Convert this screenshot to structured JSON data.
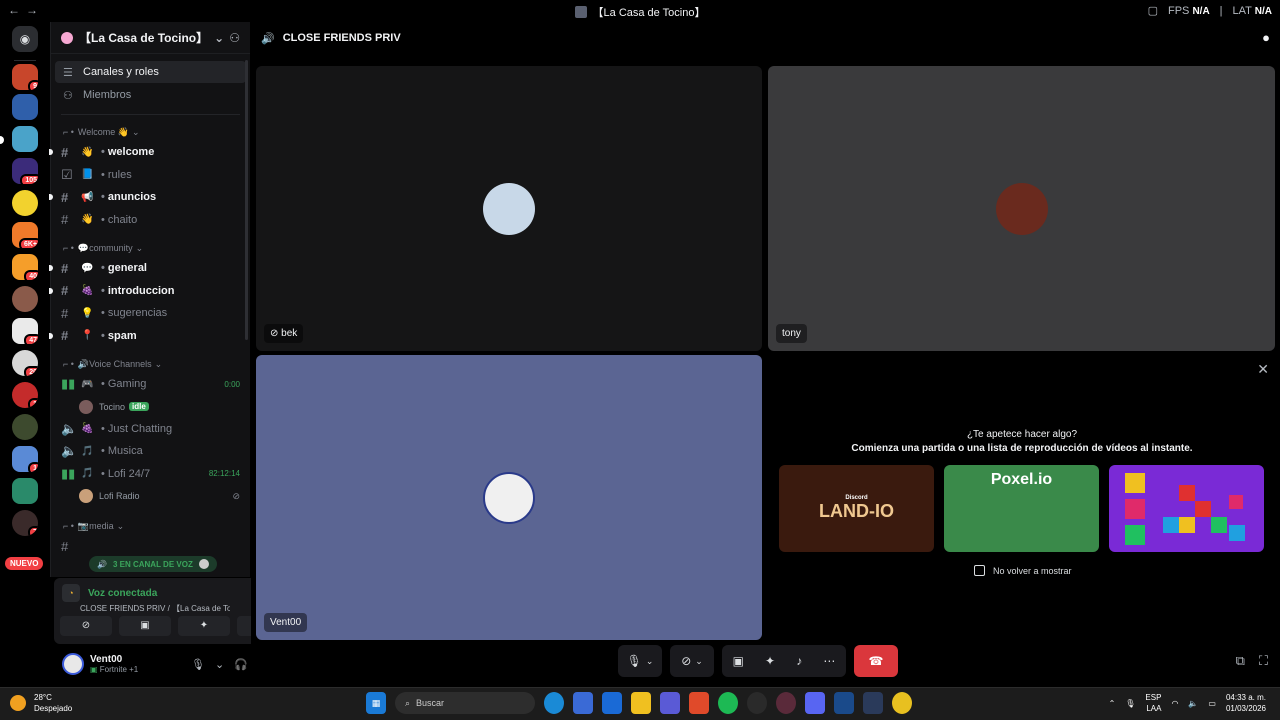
{
  "titlebar": {
    "title": "【La Casa de Tocino】",
    "fps_label": "FPS",
    "fps_value": "N/A",
    "lat_label": "LAT",
    "lat_value": "N/A"
  },
  "rail": {
    "badges": [
      "9",
      "",
      "",
      "105",
      "",
      "6K+",
      "40",
      "",
      "47",
      "20",
      "1",
      "",
      "1",
      "",
      "7"
    ],
    "new_label": "NUEVO"
  },
  "sidebar": {
    "guild_name": "【La Casa de Tocino】",
    "nav": [
      {
        "label": "Canales y roles"
      },
      {
        "label": "Miembros"
      }
    ],
    "welcome_cat": "Welcome 👋",
    "welcome_channels": [
      {
        "emoji": "👋",
        "name": "welcome"
      },
      {
        "emoji": "📘",
        "name": "rules"
      },
      {
        "emoji": "📢",
        "name": "anuncios"
      },
      {
        "emoji": "👋",
        "name": "chaito"
      }
    ],
    "community_cat": "💬community",
    "community_channels": [
      {
        "emoji": "💬",
        "name": "general"
      },
      {
        "emoji": "🍇",
        "name": "introduccion"
      },
      {
        "emoji": "💡",
        "name": "sugerencias"
      },
      {
        "emoji": "📍",
        "name": "spam"
      }
    ],
    "voice_cat": "🔊Voice Channels",
    "voice": {
      "gaming": {
        "emoji": "🎮",
        "name": "Gaming",
        "timer": "0:00",
        "user": "Tocino",
        "user_status": "idle"
      },
      "just_chatting": {
        "emoji": "🍇",
        "name": "Just Chatting"
      },
      "musica": {
        "emoji": "🎵",
        "name": "Musica"
      },
      "lofi": {
        "emoji": "🎵",
        "name": "Lofi 24/7",
        "timer": "82:12:14",
        "user": "Lofi Radio"
      }
    },
    "media_cat": "📷media",
    "voice_pill": "3 EN CANAL DE VOZ"
  },
  "voice_panel": {
    "status": "Voz conectada",
    "subtitle": "CLOSE FRIENDS PRIV / 【La Casa de To..."
  },
  "user_panel": {
    "name": "Vent00",
    "status": "Fortnite +1"
  },
  "stage": {
    "channel": "CLOSE FRIENDS PRIV",
    "tiles": [
      {
        "name": "bek"
      },
      {
        "name": "tony"
      },
      {
        "name": "Vent00"
      }
    ]
  },
  "activity": {
    "question": "¿Te apetece hacer algo?",
    "subtitle": "Comienza una partida o una lista de reproducción de vídeos al instante.",
    "cards": [
      {
        "title": "LAND-IO",
        "brand": "Discord"
      },
      {
        "title": "Poxel.io"
      }
    ],
    "dont_show": "No volver a mostrar"
  },
  "taskbar": {
    "temp": "28°C",
    "weather": "Despejado",
    "search": "Buscar",
    "lang": "ESP",
    "lang2": "LAA",
    "time": "04:33 a. m.",
    "date": "01/03/2026"
  },
  "colors": {
    "accent": "#5865f2",
    "hangup": "#da373c",
    "online": "#3ba55c",
    "tile_blue": "#5b6593"
  }
}
